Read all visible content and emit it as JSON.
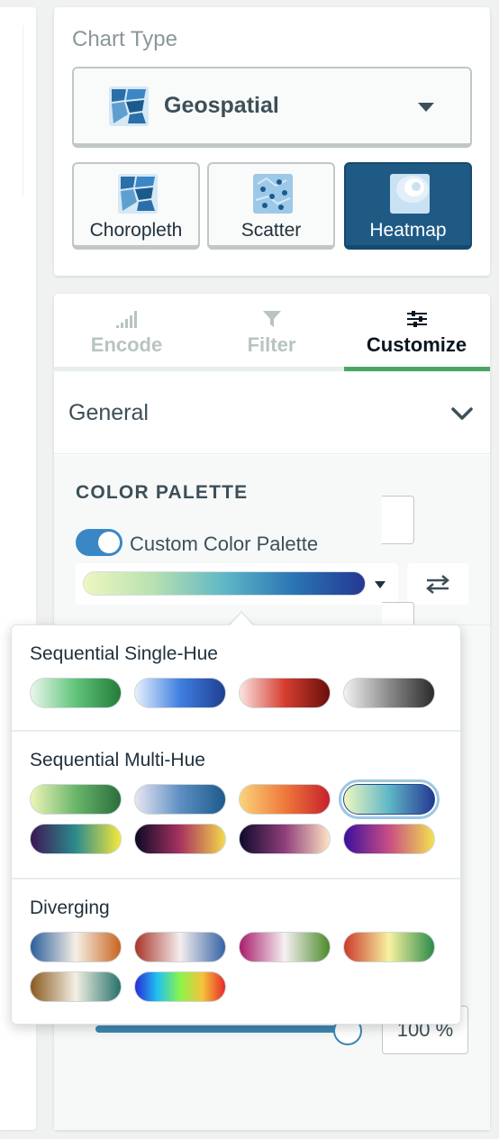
{
  "chart_type": {
    "section_label": "Chart Type",
    "selected": "Geospatial",
    "subtypes": [
      {
        "label": "Choropleth",
        "active": false
      },
      {
        "label": "Scatter",
        "active": false
      },
      {
        "label": "Heatmap",
        "active": true
      }
    ]
  },
  "tabs": [
    {
      "label": "Encode",
      "icon": "bar-signal-icon",
      "active": false
    },
    {
      "label": "Filter",
      "icon": "funnel-icon",
      "active": false
    },
    {
      "label": "Customize",
      "icon": "sliders-icon",
      "active": true
    }
  ],
  "general": {
    "title": "General",
    "color_palette_title": "COLOR PALETTE",
    "custom_palette_label": "Custom Color Palette",
    "custom_palette_enabled": true,
    "opacity_value": "100 %"
  },
  "palette_popover": {
    "groups": [
      {
        "title": "Sequential Single-Hue",
        "swatches": [
          {
            "name": "green",
            "colors": [
              "#e9f7ec",
              "#60c47a",
              "#237c3b"
            ]
          },
          {
            "name": "blue",
            "colors": [
              "#e6f0fd",
              "#3f7fe0",
              "#1f3f91"
            ]
          },
          {
            "name": "red",
            "colors": [
              "#fbe3e1",
              "#d53e2f",
              "#6a0f0c"
            ]
          },
          {
            "name": "gray",
            "colors": [
              "#f2f2f2",
              "#8a8a8a",
              "#2b2b2b"
            ]
          }
        ]
      },
      {
        "title": "Sequential Multi-Hue",
        "swatches": [
          {
            "name": "yellow-green",
            "colors": [
              "#eef5b8",
              "#6ab66b",
              "#2a6e3b"
            ]
          },
          {
            "name": "purple-blue",
            "colors": [
              "#e8e6f2",
              "#5d8fc2",
              "#1d5a8c"
            ]
          },
          {
            "name": "yellow-orange-red",
            "colors": [
              "#fbd37a",
              "#ef7a3b",
              "#c7202b"
            ]
          },
          {
            "name": "yellow-green-blue",
            "colors": [
              "#eef7c0",
              "#5fb7c6",
              "#253892"
            ],
            "selected": true
          },
          {
            "name": "viridis",
            "colors": [
              "#3d1654",
              "#2c8b8c",
              "#f6e93b"
            ]
          },
          {
            "name": "inferno",
            "colors": [
              "#0c0a26",
              "#a73360",
              "#f5d94a"
            ]
          },
          {
            "name": "magma",
            "colors": [
              "#0e0b2c",
              "#8f3d7b",
              "#fde4c3"
            ]
          },
          {
            "name": "plasma",
            "colors": [
              "#3a0f9e",
              "#c94d84",
              "#f2e24f"
            ]
          }
        ]
      },
      {
        "title": "Diverging",
        "swatches": [
          {
            "name": "blue-orange",
            "colors": [
              "#2c5e9c",
              "#f6f0e6",
              "#c7651f"
            ]
          },
          {
            "name": "red-blue",
            "colors": [
              "#a8352b",
              "#f5eeee",
              "#3563a5"
            ]
          },
          {
            "name": "pink-green",
            "colors": [
              "#a81e6b",
              "#f6f0f2",
              "#4b8b2a"
            ]
          },
          {
            "name": "red-yellow-green",
            "colors": [
              "#cc3a2b",
              "#f7f3a0",
              "#2b8a4a"
            ]
          },
          {
            "name": "brown-teal",
            "colors": [
              "#8a5a1f",
              "#f3efe3",
              "#25726a"
            ]
          },
          {
            "name": "rainbow",
            "colors": [
              "#2a2ad8",
              "#21c3f0",
              "#8bf54a",
              "#f5c23a",
              "#e8282a"
            ]
          }
        ]
      }
    ]
  },
  "colors": {
    "accent_green": "#4aa563",
    "toggle_blue": "#3b87c5",
    "active_subtype": "#1f5a85"
  }
}
